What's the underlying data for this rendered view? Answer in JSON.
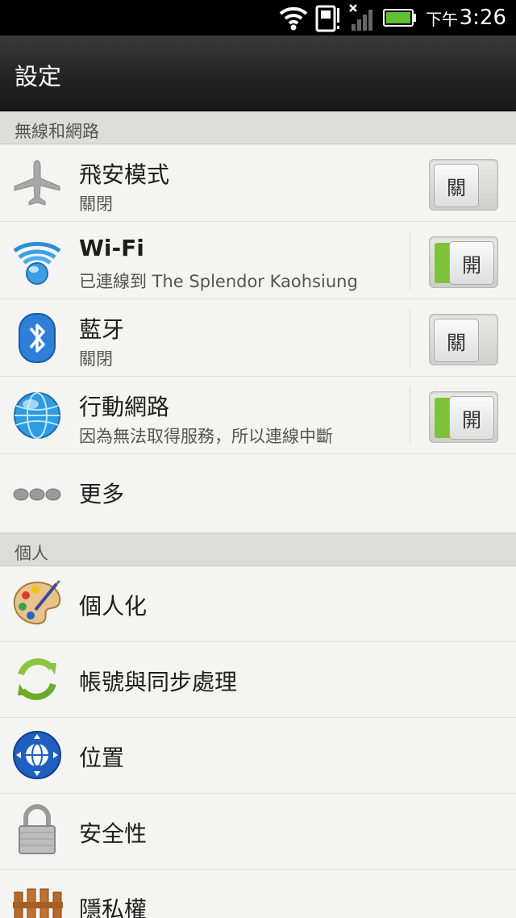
{
  "status_bar": {
    "ampm": "下午",
    "time": "3:26"
  },
  "action_bar": {
    "title": "設定"
  },
  "sections": {
    "wireless": "無線和網路",
    "personal": "個人"
  },
  "items": {
    "airplane": {
      "title": "飛安模式",
      "subtitle": "關閉",
      "toggle": "關"
    },
    "wifi": {
      "title": "Wi-Fi",
      "subtitle": "已連線到 The Splendor Kaohsiung",
      "toggle": "開"
    },
    "bluetooth": {
      "title": "藍牙",
      "subtitle": "關閉",
      "toggle": "關"
    },
    "mobile": {
      "title": "行動網路",
      "subtitle": "因為無法取得服務，所以連線中斷",
      "toggle": "開"
    },
    "more": {
      "title": "更多"
    },
    "personalize": {
      "title": "個人化"
    },
    "accounts": {
      "title": "帳號與同步處理"
    },
    "location": {
      "title": "位置"
    },
    "security": {
      "title": "安全性"
    },
    "privacy": {
      "title": "隱私權"
    }
  }
}
